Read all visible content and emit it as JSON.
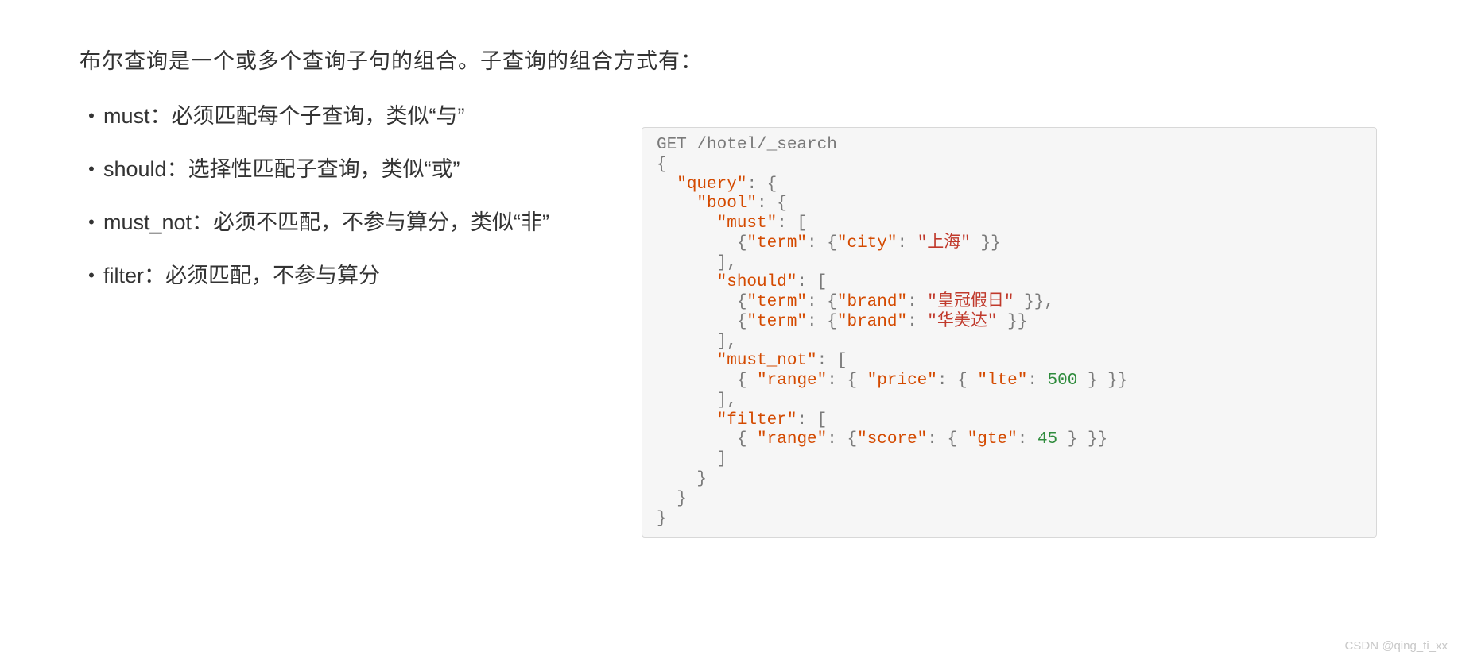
{
  "intro": "布尔查询是一个或多个查询子句的组合。子查询的组合方式有：",
  "bullets": [
    "must：必须匹配每个子查询，类似“与”",
    "should：选择性匹配子查询，类似“或”",
    "must_not：必须不匹配，不参与算分，类似“非”",
    "filter：必须匹配，不参与算分"
  ],
  "code": {
    "line01": "GET /hotel/_search",
    "l02_open": "{",
    "l03_key": "\"query\"",
    "l03_rest": ": {",
    "l04_key": "\"bool\"",
    "l04_rest": ": {",
    "l05_key": "\"must\"",
    "l05_rest": ": [",
    "l06_k1": "\"term\"",
    "l06_k2": "\"city\"",
    "l06_v": "\"上海\"",
    "l07": "],",
    "l08_key": "\"should\"",
    "l08_rest": ": [",
    "l09_k1": "\"term\"",
    "l09_k2": "\"brand\"",
    "l09_v": "\"皇冠假日\"",
    "l10_k1": "\"term\"",
    "l10_k2": "\"brand\"",
    "l10_v": "\"华美达\"",
    "l11": "],",
    "l12_key": "\"must_not\"",
    "l12_rest": ": [",
    "l13_k1": "\"range\"",
    "l13_k2": "\"price\"",
    "l13_k3": "\"lte\"",
    "l13_v": "500",
    "l14": "],",
    "l15_key": "\"filter\"",
    "l15_rest": ": [",
    "l16_k1": "\"range\"",
    "l16_k2": "\"score\"",
    "l16_k3": "\"gte\"",
    "l16_v": "45",
    "l17": "]",
    "l18": "}",
    "l19": "}",
    "l20": "}"
  },
  "watermark": "CSDN @qing_ti_xx"
}
